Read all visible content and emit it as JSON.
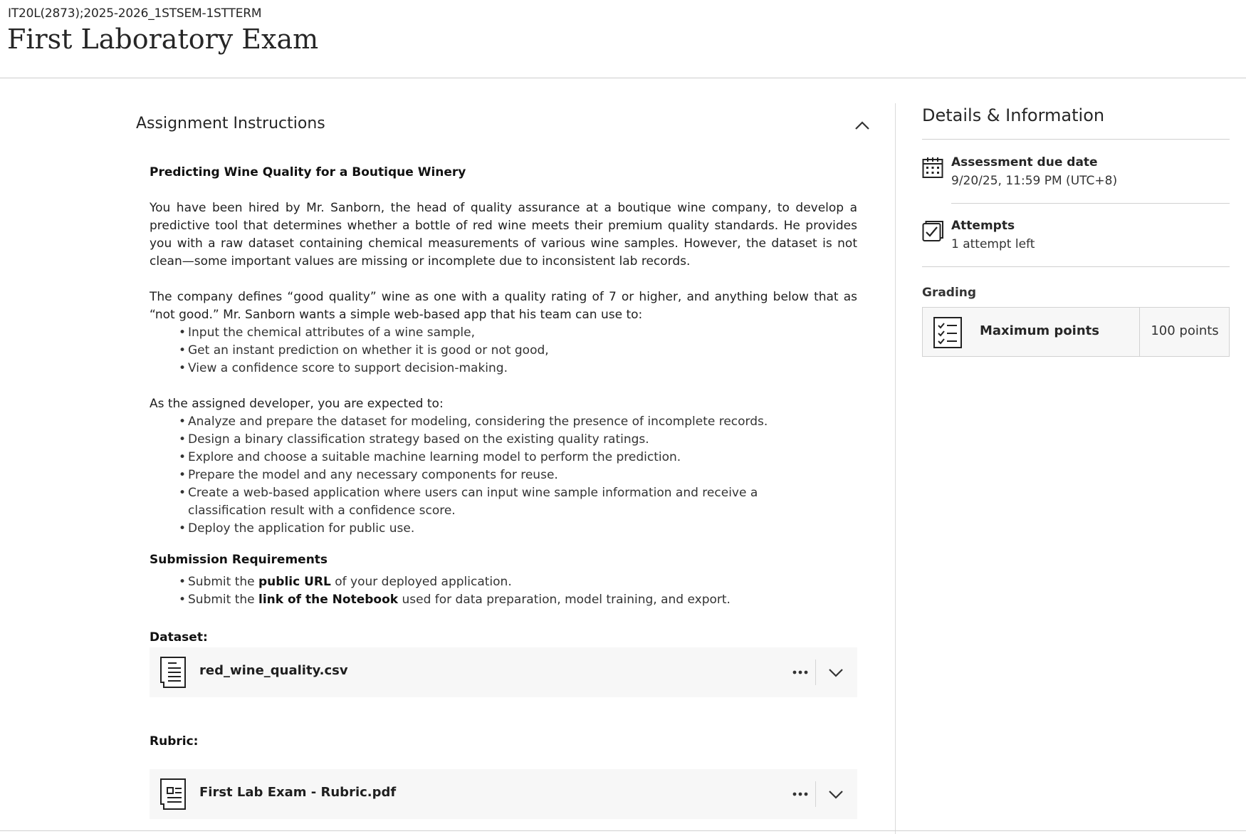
{
  "header": {
    "course_code": "IT20L(2873);2025-2026_1STSEM-1STTERM",
    "title": "First Laboratory Exam"
  },
  "instructions": {
    "section_title": "Assignment Instructions",
    "heading": "Predicting Wine Quality for a Boutique Winery",
    "paragraph1": "You have been hired by Mr. Sanborn, the head of quality assurance at a boutique wine company, to develop a predictive tool that determines whether a bottle of red wine meets their premium quality standards. He provides you with a raw dataset containing chemical measurements of various wine samples. However, the dataset is not clean—some important values are missing or incomplete due to inconsistent lab records.",
    "paragraph2": "The company defines “good quality” wine as one with a quality rating of 7 or higher, and anything below that as “not good.” Mr. Sanborn wants a simple web-based app that his team can use to:",
    "list1": [
      "Input the chemical attributes of a wine sample,",
      "Get an instant prediction on whether it is good or not good,",
      "View a confidence score to support decision-making."
    ],
    "paragraph3": "As the assigned developer, you are expected to:",
    "list2": [
      "Analyze and prepare the dataset for modeling, considering the presence of incomplete records.",
      "Design a binary classification strategy based on the existing quality ratings.",
      "Explore and choose a suitable machine learning model to perform the prediction.",
      "Prepare the model and any necessary components for reuse.",
      "Create a web-based application where users can input wine sample information and receive a classification result with a confidence score.",
      "Deploy the application for public use."
    ],
    "submission_heading": "Submission Requirements",
    "submission": [
      {
        "pre": "Submit the ",
        "bold": "public URL",
        "post": " of your deployed application."
      },
      {
        "pre": "Submit the ",
        "bold": "link of the Notebook",
        "post": " used for data preparation, model training, and export."
      }
    ],
    "dataset_label": "Dataset:",
    "dataset_file": "red_wine_quality.csv",
    "rubric_label": "Rubric:",
    "rubric_file": "First Lab Exam - Rubric.pdf"
  },
  "details": {
    "title": "Details & Information",
    "due_label": "Assessment due date",
    "due_value": "9/20/25, 11:59 PM (UTC+8)",
    "attempts_label": "Attempts",
    "attempts_value": "1 attempt left",
    "grading_label": "Grading",
    "max_points_label": "Maximum points",
    "max_points_value": "100 points"
  },
  "icons": [
    "chevron-up-icon",
    "calendar-icon",
    "checkbox-icon",
    "rubric-list-icon",
    "document-icon",
    "more-icon",
    "chevron-down-icon"
  ],
  "colors": {
    "text": "#262626",
    "card_bg": "#f7f7f7",
    "divider": "#d0d0d0"
  }
}
